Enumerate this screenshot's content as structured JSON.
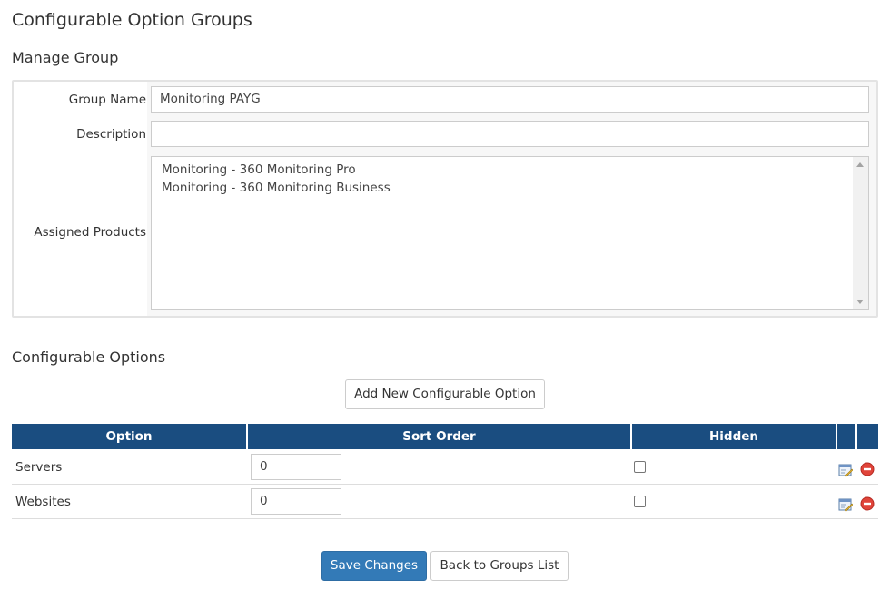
{
  "page": {
    "title": "Configurable Option Groups"
  },
  "manage_group": {
    "title": "Manage Group",
    "group_name_label": "Group Name",
    "group_name_value": "Monitoring PAYG",
    "description_label": "Description",
    "description_value": "",
    "assigned_products_label": "Assigned Products",
    "assigned_products": [
      "Monitoring - 360 Monitoring Pro",
      "Monitoring - 360 Monitoring Business"
    ]
  },
  "configurable_options": {
    "title": "Configurable Options",
    "add_button_label": "Add New Configurable Option",
    "columns": [
      "Option",
      "Sort Order",
      "Hidden",
      "",
      ""
    ],
    "rows": [
      {
        "option": "Servers",
        "sort_order": "0",
        "hidden": false
      },
      {
        "option": "Websites",
        "sort_order": "0",
        "hidden": false
      }
    ]
  },
  "footer": {
    "save_label": "Save Changes",
    "back_label": "Back to Groups List"
  },
  "colors": {
    "header_bg": "#1a4d80",
    "primary_button": "#337ab7",
    "delete_icon": "#e0443a"
  },
  "icons": {
    "edit": "edit-icon",
    "delete": "delete-icon"
  }
}
